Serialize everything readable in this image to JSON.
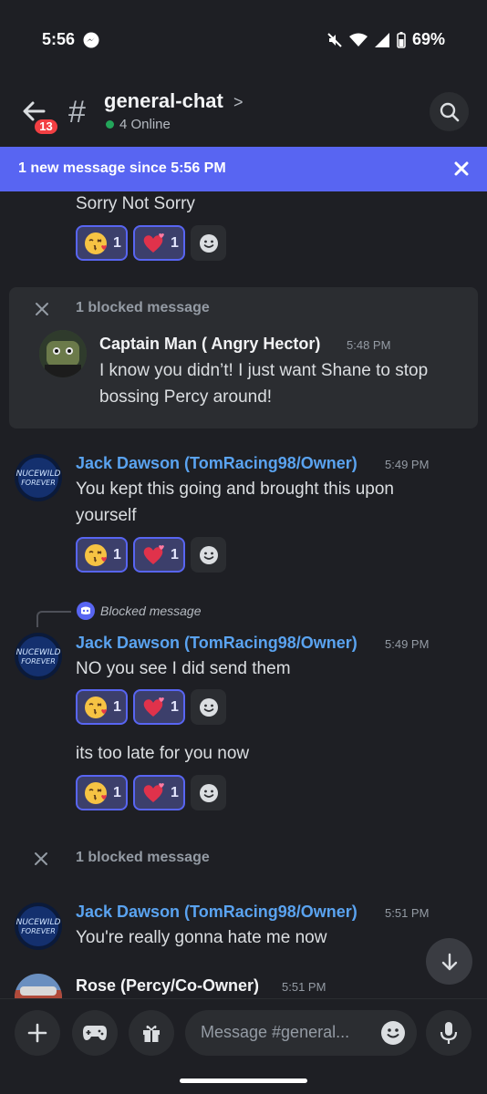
{
  "status": {
    "time": "5:56",
    "battery": "69%"
  },
  "header": {
    "badge": "13",
    "channel": "general-chat",
    "chevron": ">",
    "online": "4 Online"
  },
  "banner": {
    "text": "1 new message since 5:56 PM"
  },
  "messages": {
    "m0": {
      "text": "Sorry Not Sorry"
    },
    "blocked1": {
      "label": "1 blocked message",
      "author": "Captain Man ( Angry Hector)",
      "time": "5:48 PM",
      "text_line1": "I know you didn’t! I just want Shane to stop",
      "text_line2": "bossing Percy around!"
    },
    "m1": {
      "author": "Jack Dawson (TomRacing98/Owner)",
      "time": "5:49 PM",
      "text_line1": "You kept this going and brought this upon",
      "text_line2": "yourself"
    },
    "reply": {
      "text": "Blocked message"
    },
    "m2": {
      "author": "Jack Dawson (TomRacing98/Owner)",
      "time": "5:49 PM",
      "text": "NO you see I did send them"
    },
    "m3": {
      "text": "its too late for you now"
    },
    "blocked2": {
      "label": "1 blocked message"
    },
    "m4": {
      "author": "Jack Dawson (TomRacing98/Owner)",
      "time": "5:51 PM",
      "text": "You're really gonna hate me now"
    },
    "m5": {
      "author": "Rose (Percy/Co-Owner)",
      "time": "5:51 PM"
    }
  },
  "reactions": {
    "kiss_count": "1",
    "heart_count": "1"
  },
  "composer": {
    "placeholder": "Message #general..."
  },
  "colors": {
    "accent": "#5865f2",
    "owner_name": "#5aa3f0",
    "online": "#23a55a",
    "badge": "#f23f43"
  },
  "icons": [
    "back-arrow-icon",
    "search-icon",
    "close-icon",
    "smile-add-icon",
    "kiss-emoji-icon",
    "heart-emoji-icon",
    "plus-icon",
    "gamepad-icon",
    "gift-icon",
    "mic-icon",
    "chevron-down-icon"
  ]
}
